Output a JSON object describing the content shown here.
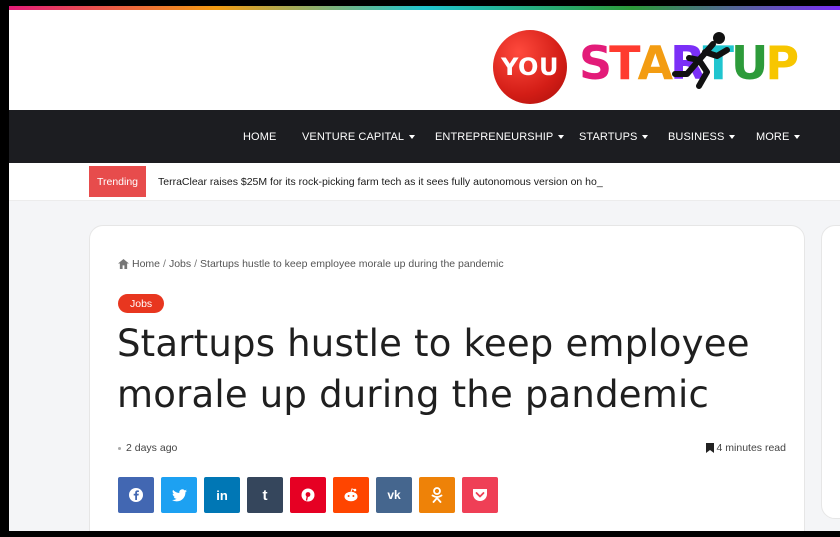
{
  "logo": {
    "circle_text": "YOU",
    "word_letters": [
      "S",
      "T",
      "A",
      "R",
      "T",
      "U",
      "P"
    ]
  },
  "nav": {
    "items": [
      {
        "label": "HOME",
        "dropdown": false
      },
      {
        "label": "VENTURE CAPITAL",
        "dropdown": true
      },
      {
        "label": "ENTREPRENEURSHIP",
        "dropdown": true
      },
      {
        "label": "STARTUPS",
        "dropdown": true
      },
      {
        "label": "BUSINESS",
        "dropdown": true
      },
      {
        "label": "MORE",
        "dropdown": true
      }
    ],
    "dark_mode_icon": "moon-icon"
  },
  "trending": {
    "badge": "Trending",
    "headline": "TerraClear raises $25M for its rock-picking farm tech as it sees fully autonomous version on ho_"
  },
  "article": {
    "breadcrumb": [
      "Home",
      "Jobs",
      "Startups hustle to keep employee morale up during the pandemic"
    ],
    "category": "Jobs",
    "title": "Startups hustle to keep employee morale up during the pandemic",
    "date": "2 days ago",
    "read_time": "4 minutes read"
  },
  "share": [
    {
      "name": "facebook",
      "glyph": "f",
      "color": "#4267b2"
    },
    {
      "name": "twitter",
      "glyph": "t",
      "color": "#1da1f2"
    },
    {
      "name": "linkedin",
      "glyph": "in",
      "color": "#0077b5"
    },
    {
      "name": "tumblr",
      "glyph": "t",
      "color": "#35465c"
    },
    {
      "name": "pinterest",
      "glyph": "P",
      "color": "#e60023"
    },
    {
      "name": "reddit",
      "glyph": "r",
      "color": "#ff4500"
    },
    {
      "name": "vk",
      "glyph": "vk",
      "color": "#45668e"
    },
    {
      "name": "odnoklassniki",
      "glyph": "ok",
      "color": "#ee8208"
    },
    {
      "name": "pocket",
      "glyph": "p",
      "color": "#ef3f56"
    }
  ],
  "colors": {
    "nav_bg": "#1c1d21",
    "accent": "#e8361f",
    "trending": "#e74c4c"
  }
}
